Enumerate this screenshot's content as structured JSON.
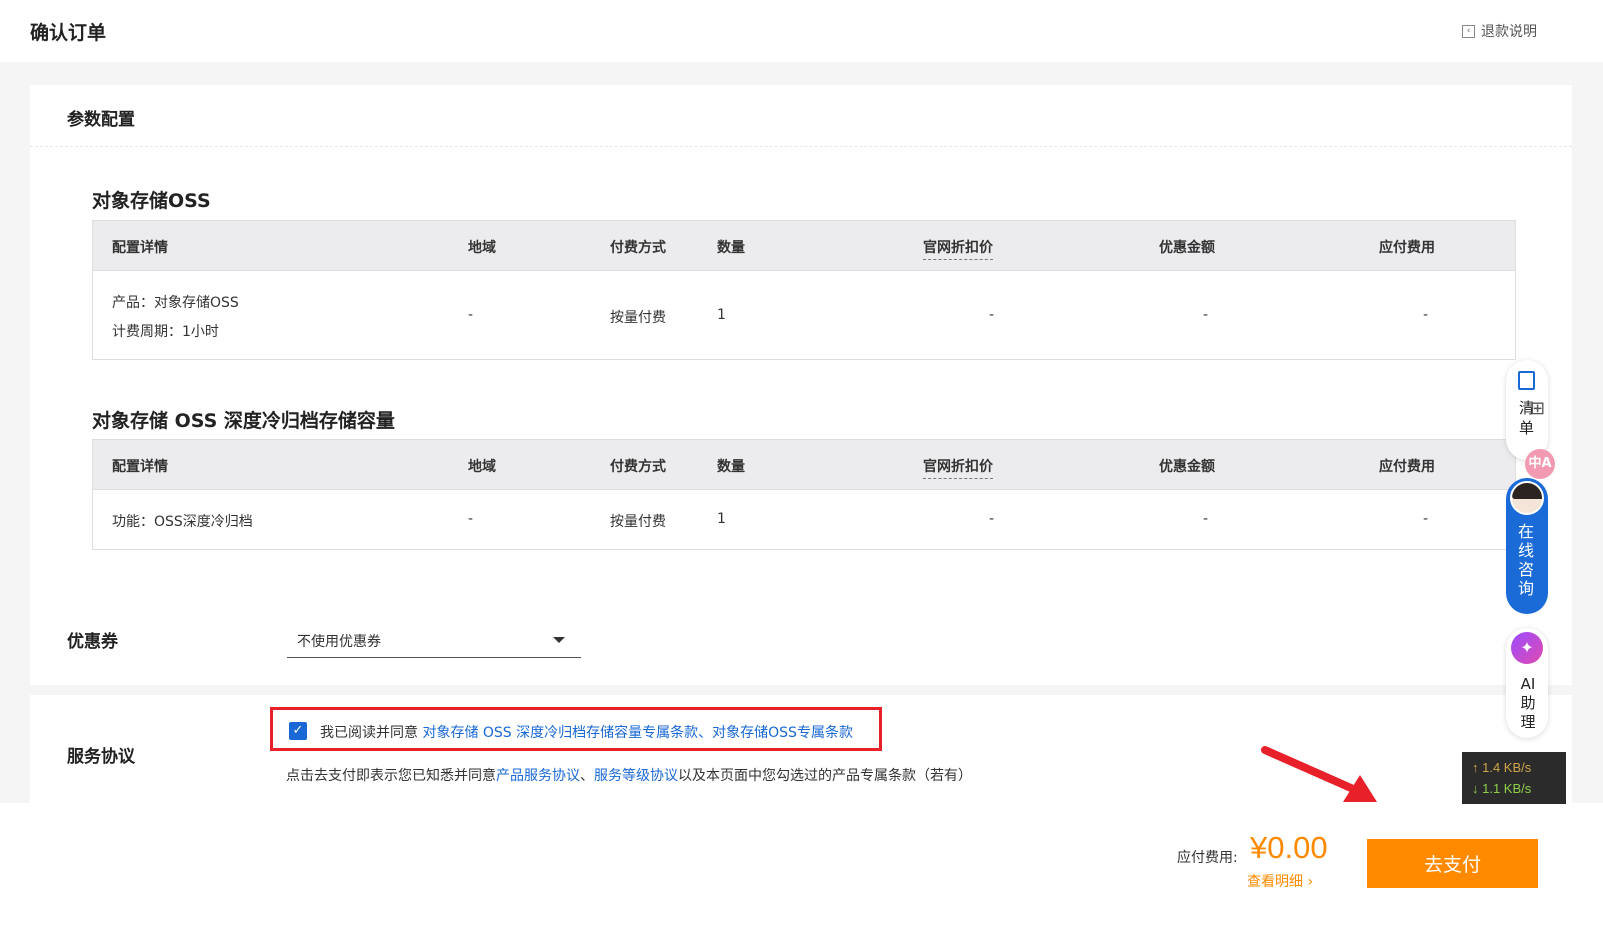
{
  "header": {
    "title": "确认订单",
    "refund_link": "退款说明"
  },
  "params": {
    "section_title": "参数配置",
    "columns": [
      "配置详情",
      "地域",
      "付费方式",
      "数量",
      "官网折扣价",
      "优惠金额",
      "应付费用"
    ],
    "products": [
      {
        "title": "对象存储OSS",
        "row": {
          "config_lines": [
            "产品：对象存储OSS",
            "计费周期：1小时"
          ],
          "region": "-",
          "payment": "按量付费",
          "quantity": "1",
          "list_price": "-",
          "discount": "-",
          "due": "-"
        }
      },
      {
        "title": "对象存储 OSS 深度冷归档存储容量",
        "row": {
          "config_lines": [
            "功能：OSS深度冷归档"
          ],
          "region": "-",
          "payment": "按量付费",
          "quantity": "1",
          "list_price": "-",
          "discount": "-",
          "due": "-"
        }
      }
    ]
  },
  "coupon": {
    "label": "优惠券",
    "selected": "不使用优惠券"
  },
  "service": {
    "label": "服务协议",
    "agree_prefix": "我已阅读并同意",
    "agree_link1": "对象存储 OSS 深度冷归档存储容量专属条款",
    "agree_sep": "、",
    "agree_link2": "对象存储OSS专属条款",
    "checked": true,
    "notice_prefix": "点击去支付即表示您已知悉并同意",
    "notice_link1": "产品服务协议",
    "notice_sep": "、",
    "notice_link2": "服务等级协议",
    "notice_suffix": "以及本页面中您勾选过的产品专属条款（若有）"
  },
  "footer": {
    "due_label": "应付费用:",
    "amount": "¥0.00",
    "detail_link": "查看明细",
    "pay_button": "去支付"
  },
  "sidebar": {
    "cart_label": "清单",
    "translate_label": "中A",
    "consult_label": "在线咨询",
    "ai_label": "AI助理"
  },
  "network": {
    "upload": "↑ 1.4 KB/s",
    "download": "↓ 1.1 KB/s"
  },
  "colors": {
    "accent": "#ff8a00",
    "link": "#1968d6",
    "highlight": "#e8202a"
  }
}
